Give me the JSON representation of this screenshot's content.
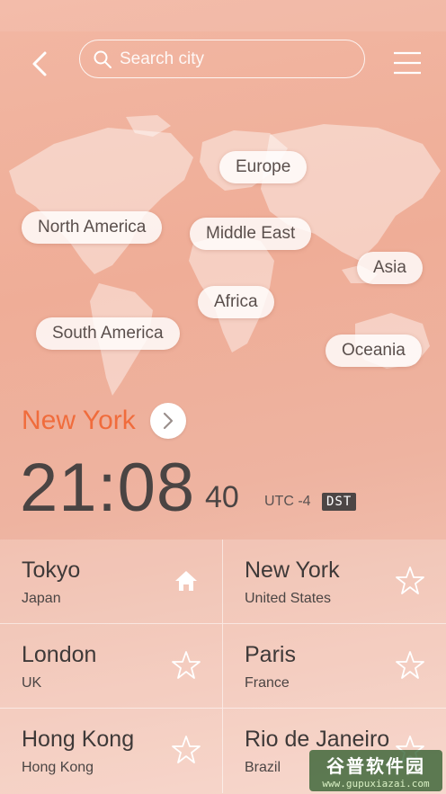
{
  "search": {
    "placeholder": "Search city"
  },
  "regions": [
    {
      "label": "Europe"
    },
    {
      "label": "North America"
    },
    {
      "label": "Middle East"
    },
    {
      "label": "Asia"
    },
    {
      "label": "Africa"
    },
    {
      "label": "South America"
    },
    {
      "label": "Oceania"
    }
  ],
  "current": {
    "city": "New York",
    "time_main": "21:08",
    "seconds": "40",
    "utc": "UTC -4",
    "dst": "DST"
  },
  "cities": [
    {
      "name": "Tokyo",
      "country": "Japan",
      "icon": "home-icon"
    },
    {
      "name": "New York",
      "country": "United States",
      "icon": "star-icon"
    },
    {
      "name": "London",
      "country": "UK",
      "icon": "star-icon"
    },
    {
      "name": "Paris",
      "country": "France",
      "icon": "star-icon"
    },
    {
      "name": "Hong Kong",
      "country": "Hong Kong",
      "icon": "star-icon"
    },
    {
      "name": "Rio de Janeiro",
      "country": "Brazil",
      "icon": "star-icon"
    }
  ],
  "watermark": {
    "line1": "谷普软件园",
    "line2": "www.gupuxiazai.com"
  },
  "colors": {
    "accent": "#f06c3c",
    "text": "#4a4443"
  }
}
